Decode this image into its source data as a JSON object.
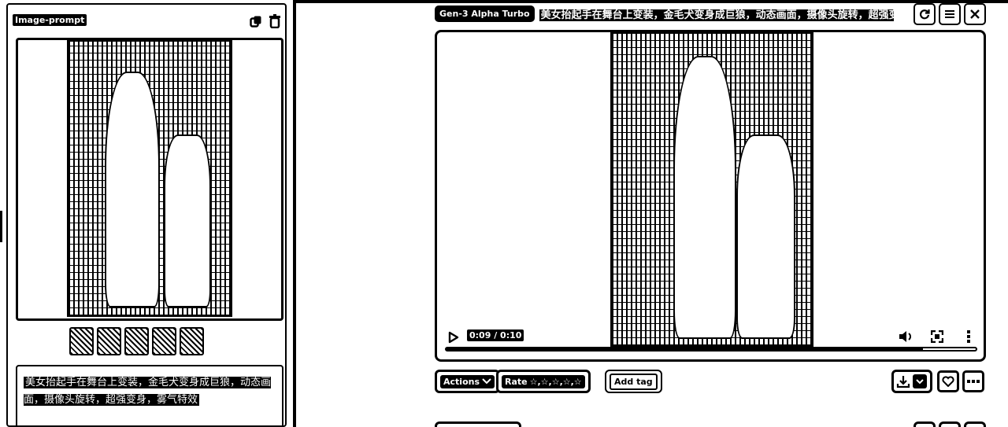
{
  "left_panel": {
    "tag": "Image-prompt",
    "prompt_text": "美女抬起手在舞台上变装，金毛犬变身成巨狼，动态画面，摄像头旋转，超强变身，雾气特效"
  },
  "header": {
    "model_badge": "Gen-3 Alpha Turbo",
    "title": "美女抬起手在舞台上变装，金毛犬变身成巨狼，动态画面，摄像头旋转，超强变..."
  },
  "video": {
    "time": "0:09 / 0:10",
    "progress": 0.9
  },
  "actions": {
    "actions_label": "Actions",
    "rate_label": "Rate",
    "rating_stars": "☆,☆,☆,☆,☆",
    "add_tag_label": "Add tag"
  },
  "icons": {
    "copy": "copy-icon",
    "delete": "trash-icon",
    "refresh": "refresh-icon",
    "menu": "menu-icon",
    "close": "close-icon",
    "play": "play-icon",
    "volume": "volume-icon",
    "fullscreen": "fullscreen-icon",
    "more": "more-vertical-icon",
    "download": "download-icon",
    "favorite": "heart-icon",
    "more_actions": "more-horizontal-icon"
  }
}
